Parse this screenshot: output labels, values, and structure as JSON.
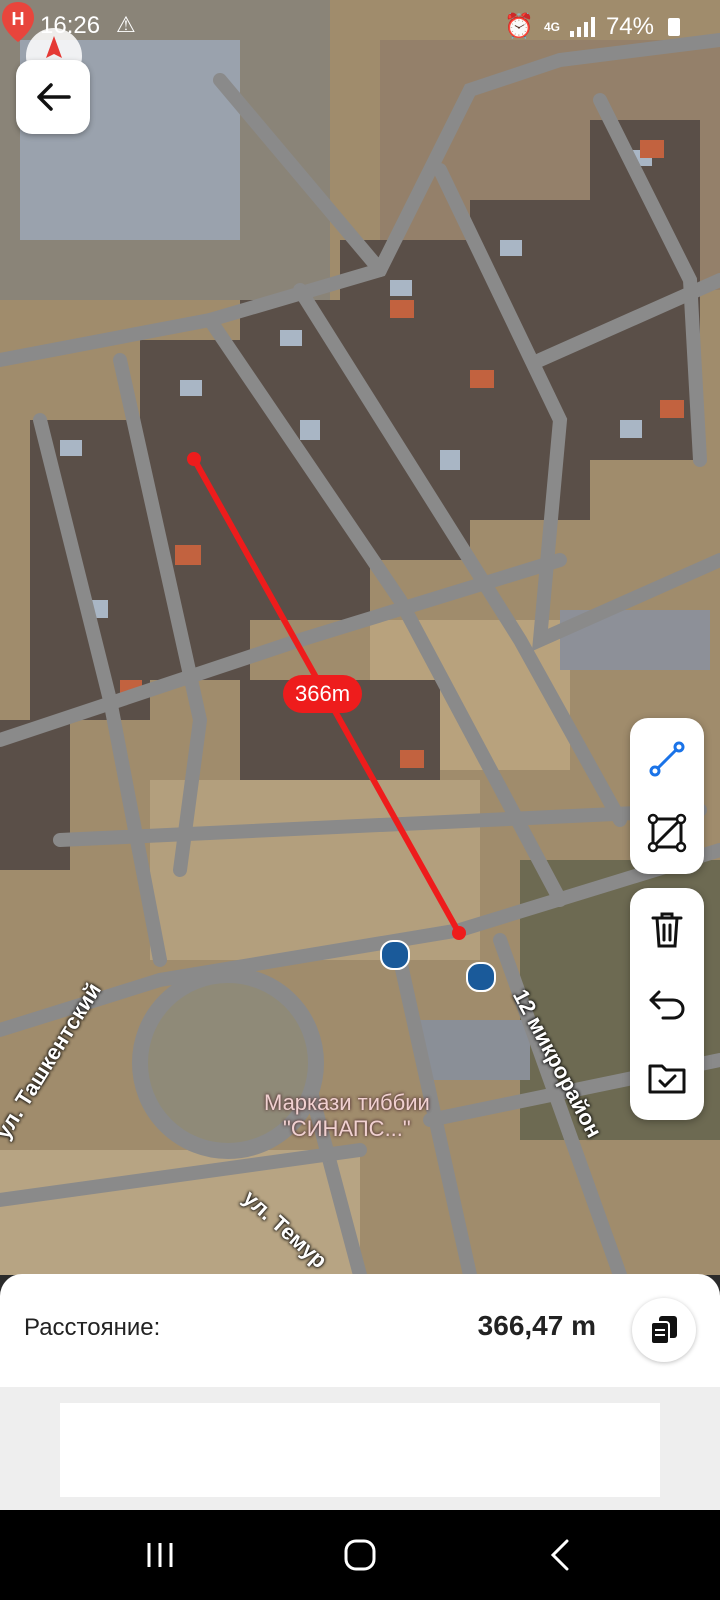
{
  "status_bar": {
    "time": "16:26",
    "network": "4G",
    "battery": "74%"
  },
  "map": {
    "measure_label": "366m",
    "poi": {
      "name_line1": "Маркази тиббии",
      "name_line2": "\"СИНАПС...\"",
      "pin_letter": "H"
    },
    "streets": {
      "tashkent": "ул. Ташкентский",
      "temur": "ул. Темур",
      "microdistrict": "12 микрорайон"
    }
  },
  "toolbar": {
    "line_tool": "line-tool-icon",
    "polygon_tool": "polygon-tool-icon",
    "delete": "trash-icon",
    "undo": "undo-icon",
    "save": "folder-check-icon"
  },
  "result_panel": {
    "label": "Расстояние:",
    "value": "366,47 m"
  },
  "colors": {
    "measure_line": "#ee1c1c",
    "accent": "#1a73e8"
  }
}
